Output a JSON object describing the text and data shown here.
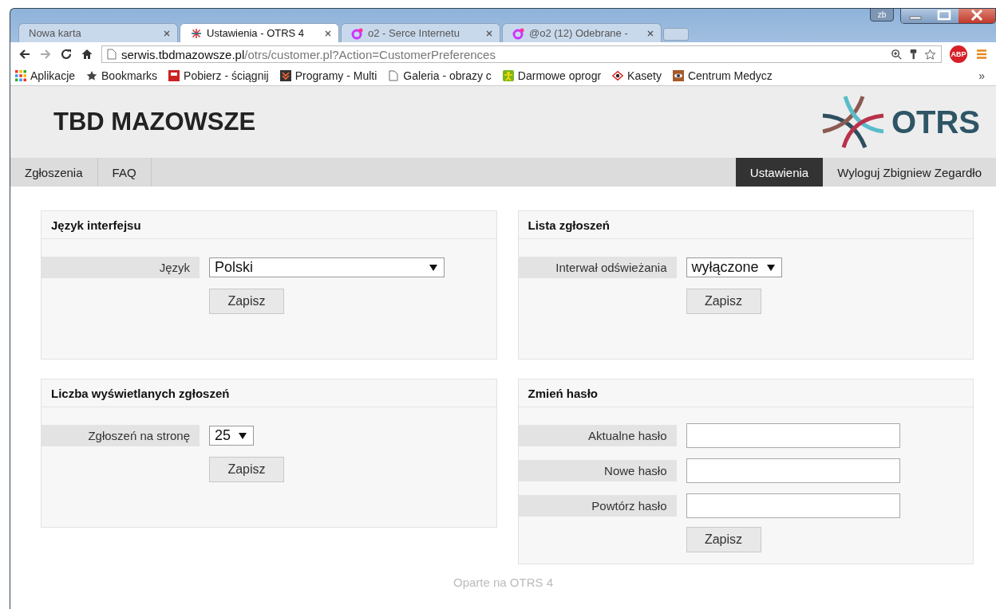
{
  "window": {
    "profile": "zb"
  },
  "tabs": [
    {
      "title": "Nowa karta",
      "selected": false
    },
    {
      "title": "Ustawienia - OTRS 4",
      "selected": true
    },
    {
      "title": "o2 - Serce Internetu",
      "selected": false
    },
    {
      "title": "@o2 (12) Odebrane -",
      "selected": false
    }
  ],
  "address": {
    "host": "serwis.tbdmazowsze.pl",
    "path": "/otrs/customer.pl?Action=CustomerPreferences"
  },
  "extension": "ABP",
  "bookmarks": [
    {
      "label": "Aplikacje"
    },
    {
      "label": "Bookmarks"
    },
    {
      "label": "Pobierz - ściągnij"
    },
    {
      "label": "Programy - Multi"
    },
    {
      "label": "Galeria - obrazy c"
    },
    {
      "label": "Darmowe oprogr"
    },
    {
      "label": "Kasety"
    },
    {
      "label": "Centrum Medycz"
    }
  ],
  "bookmarks_more": "»",
  "header": {
    "title": "TBD MAZOWSZE",
    "logo": "OTRS"
  },
  "nav_left": [
    {
      "label": "Zgłoszenia",
      "selected": false
    },
    {
      "label": "FAQ",
      "selected": false
    }
  ],
  "nav_right": [
    {
      "label": "Ustawienia",
      "selected": true
    },
    {
      "label": "Wyloguj Zbigniew Zegardło",
      "selected": false
    }
  ],
  "columns": [
    [
      {
        "title": "Język interfejsu",
        "rows": [
          {
            "kind": "select",
            "label": "Język",
            "value": "Polski",
            "wide": true
          }
        ],
        "button": "Zapisz"
      },
      {
        "title": "Liczba wyświetlanych zgłoszeń",
        "rows": [
          {
            "kind": "select",
            "label": "Zgłoszeń na stronę",
            "value": "25",
            "wide": false
          }
        ],
        "button": "Zapisz"
      }
    ],
    [
      {
        "title": "Lista zgłoszeń",
        "rows": [
          {
            "kind": "select",
            "label": "Interwał odświeżania",
            "value": "wyłączone",
            "wide": false
          }
        ],
        "button": "Zapisz"
      },
      {
        "title": "Zmień hasło",
        "rows": [
          {
            "kind": "password",
            "label": "Aktualne hasło"
          },
          {
            "kind": "password",
            "label": "Nowe hasło"
          },
          {
            "kind": "password",
            "label": "Powtórz hasło"
          }
        ],
        "button": "Zapisz"
      }
    ]
  ],
  "footer": "Oparte na OTRS 4"
}
